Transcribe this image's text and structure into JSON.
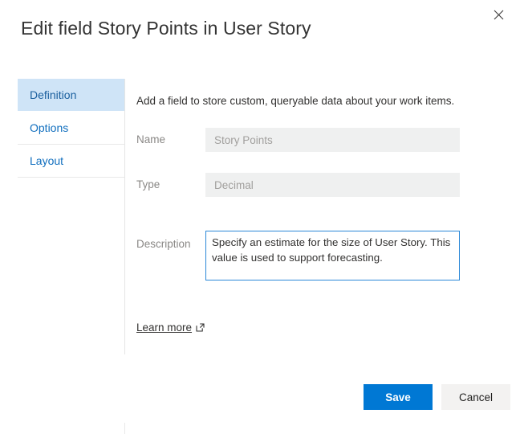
{
  "dialog": {
    "title": "Edit field Story Points in User Story",
    "close_icon": "close-icon",
    "close_label": "Close"
  },
  "nav": {
    "items": [
      {
        "label": "Definition",
        "selected": true
      },
      {
        "label": "Options",
        "selected": false
      },
      {
        "label": "Layout",
        "selected": false
      }
    ]
  },
  "content": {
    "intro": "Add a field to store custom, queryable data about your work items.",
    "fields": [
      {
        "label": "Name",
        "value": "Story Points",
        "placeholder": "Story Points",
        "readonly": true
      },
      {
        "label": "Type",
        "value": "Decimal",
        "placeholder": "Decimal",
        "readonly": true
      }
    ],
    "description": {
      "label": "Description",
      "value": "Specify an estimate for the size of User Story. This value is used to support forecasting.",
      "placeholder": ""
    },
    "learn_more": {
      "label": "Learn more",
      "icon": "external-link-icon"
    }
  },
  "footer": {
    "save_label": "Save",
    "cancel_label": "Cancel"
  },
  "colors": {
    "accent": "#0078d4",
    "nav_selected_bg": "#cfe4f7",
    "nav_link": "#106ebe",
    "focus_border": "#2b88d8",
    "readonly_bg": "#eff0f0",
    "label_grey": "#8a8886",
    "cancel_bg": "#f3f2f1"
  }
}
